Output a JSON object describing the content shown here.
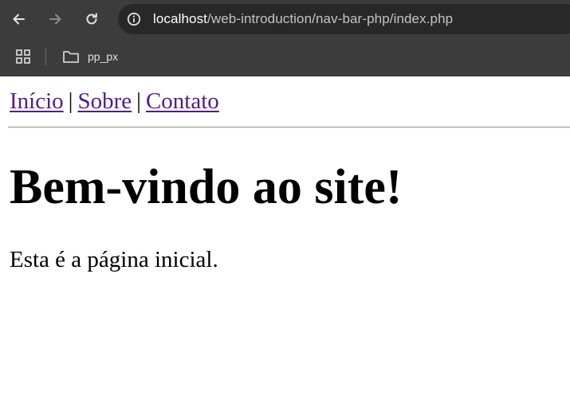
{
  "browser": {
    "url_host": "localhost",
    "url_path": "/web-introduction/nav-bar-php/index.php",
    "bookmarks": [
      {
        "label": "pp_px",
        "icon": "folder-icon"
      }
    ],
    "icons": {
      "back": "back-arrow-icon",
      "forward": "forward-arrow-icon",
      "reload": "reload-icon",
      "site_info": "info-icon",
      "apps": "apps-grid-icon"
    },
    "colors": {
      "frame": "#3c3c3c",
      "omnibox": "#282828"
    }
  },
  "page": {
    "nav": {
      "links": [
        "Início",
        "Sobre",
        "Contato"
      ],
      "separator": "|"
    },
    "heading": "Bem-vindo ao site!",
    "paragraph": "Esta é a página inicial.",
    "colors": {
      "link": "#551a8b",
      "text": "#000000"
    }
  }
}
